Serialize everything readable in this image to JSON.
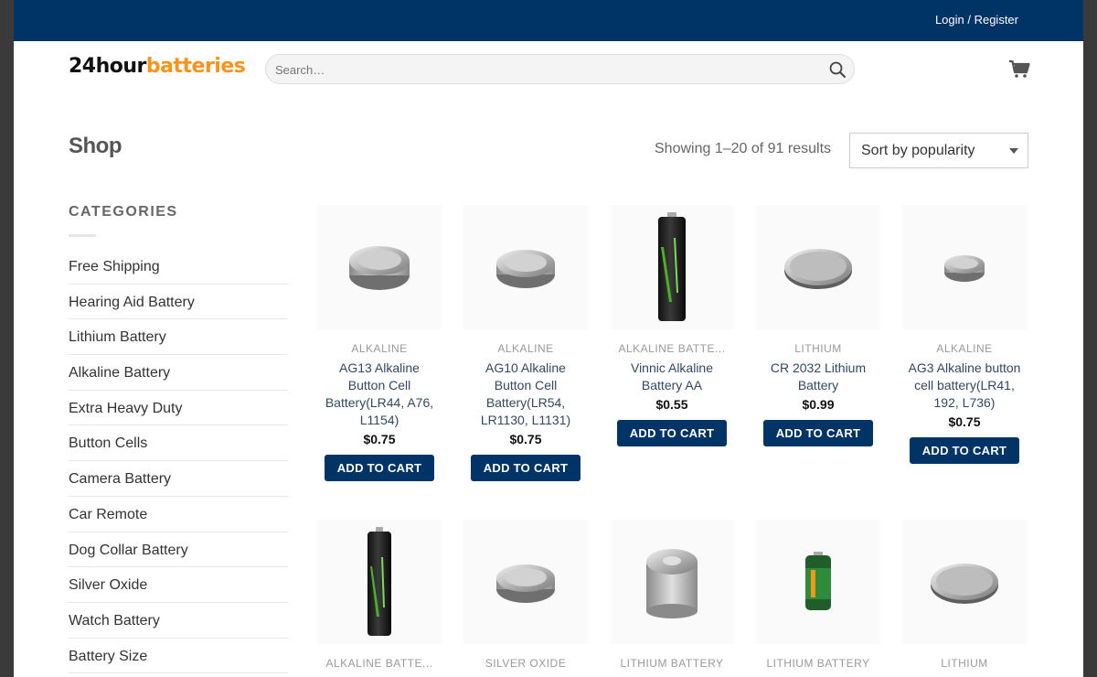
{
  "topbar": {
    "login_label": "Login / Register"
  },
  "logo": {
    "part1": "24hour",
    "part2": "batteries"
  },
  "search": {
    "placeholder": "Search…"
  },
  "shop": {
    "title": "Shop",
    "results": "Showing 1–20 of 91 results",
    "sort_selected": "Sort by popularity"
  },
  "sidebar": {
    "heading": "CATEGORIES",
    "items": [
      "Free Shipping",
      "Hearing Aid Battery",
      "Lithium Battery",
      "Alkaline Battery",
      "Extra Heavy Duty",
      "Button Cells",
      "Camera Battery",
      "Car Remote",
      "Dog Collar Battery",
      "Silver Oxide",
      "Watch Battery",
      "Battery Size"
    ]
  },
  "products": [
    {
      "category": "ALKALINE",
      "name": "AG13 Alkaline Button Cell Battery(LR44, A76, L1154)",
      "price": "$0.75",
      "button": "ADD TO CART",
      "image": "button-cell-thick-icon"
    },
    {
      "category": "ALKALINE",
      "name": "AG10 Alkaline Button Cell Battery(LR54, LR1130, L1131)",
      "price": "$0.75",
      "button": "ADD TO CART",
      "image": "button-cell-icon"
    },
    {
      "category": "ALKALINE BATTE...",
      "name": "Vinnic Alkaline Battery AA",
      "price": "$0.55",
      "button": "ADD TO CART",
      "image": "aa-battery-icon"
    },
    {
      "category": "LITHIUM",
      "name": "CR 2032 Lithium Battery",
      "price": "$0.99",
      "button": "ADD TO CART",
      "image": "coin-cell-icon"
    },
    {
      "category": "ALKALINE",
      "name": "AG3 Alkaline button cell battery(LR41, 192, L736)",
      "price": "$0.75",
      "button": "ADD TO CART",
      "image": "small-button-cell-icon"
    },
    {
      "category": "ALKALINE BATTE...",
      "name": "",
      "price": "",
      "button": "",
      "image": "aaa-battery-icon"
    },
    {
      "category": "SILVER OXIDE",
      "name": "",
      "price": "",
      "button": "",
      "image": "button-cell-icon"
    },
    {
      "category": "LITHIUM BATTERY",
      "name": "",
      "price": "",
      "button": "",
      "image": "cr2-battery-icon"
    },
    {
      "category": "LITHIUM BATTERY",
      "name": "",
      "price": "",
      "button": "",
      "image": "cr123-battery-icon"
    },
    {
      "category": "LITHIUM",
      "name": "",
      "price": "",
      "button": "",
      "image": "coin-cell-icon"
    }
  ],
  "colors": {
    "topbar": "#003366",
    "accent": "#f7941d",
    "button": "#003366",
    "link": "#334862"
  }
}
